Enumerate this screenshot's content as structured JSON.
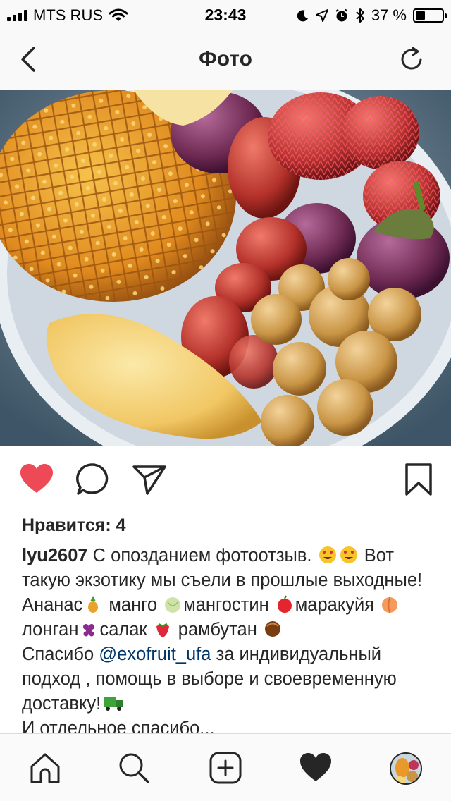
{
  "status_bar": {
    "carrier": "MTS RUS",
    "time": "23:43",
    "battery_percent": "37 %",
    "battery_level": 0.37
  },
  "nav": {
    "title": "Фото",
    "back_icon": "chevron-left-icon",
    "refresh_icon": "refresh-icon"
  },
  "photo": {
    "subject": "fruit-bowl-image"
  },
  "actions": {
    "like_icon": "heart-filled-icon",
    "like_color": "#ed4956",
    "comment_icon": "comment-icon",
    "share_icon": "send-icon",
    "save_icon": "bookmark-icon"
  },
  "post": {
    "likes": "Нравится: 4",
    "username": "lyu2607",
    "line1": " С опозданием фотоотзыв. ",
    "line2_a": "Вот такую экзотику мы съели в прошлые выходные! Ананас",
    "line2_b": " манго ",
    "line2_c": "мангостин ",
    "line2_d": "маракуйя ",
    "line2_e": "лонган",
    "line2_f": "салак ",
    "line2_g": " рамбутан ",
    "thanks_a": "Спасибо ",
    "mention": "@exofruit_ufa",
    "thanks_b": " за индивидуальный подход , помощь в выборе и своевременную доставку!",
    "cut_line": "И отдельное спасибо..."
  },
  "tab_bar": {
    "items": [
      "home-icon",
      "search-icon",
      "add-post-icon",
      "activity-heart-icon",
      "profile-avatar"
    ]
  },
  "colors": {
    "background": "#ffffff",
    "bar_background": "#f9f9f9",
    "text": "#262626",
    "mention": "#003569",
    "like_red": "#ed4956"
  }
}
